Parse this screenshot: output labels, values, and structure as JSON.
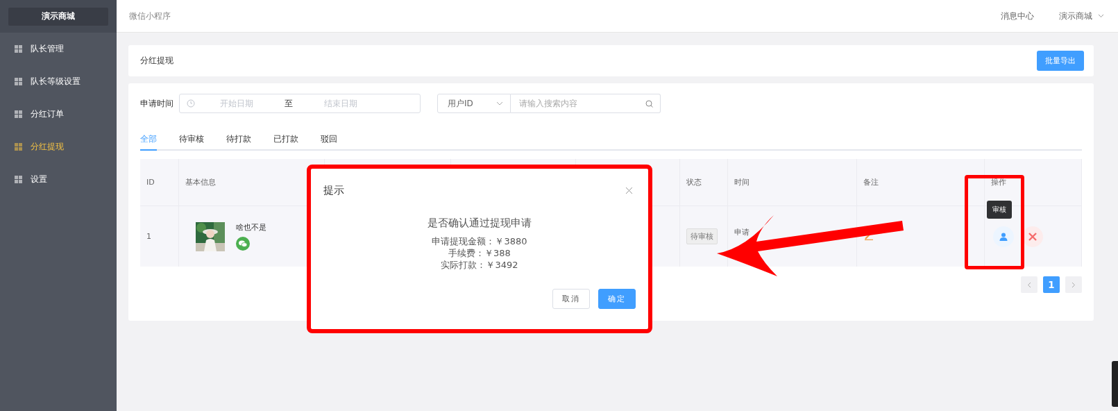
{
  "header": {
    "brand": "演示商城",
    "app_name": "微信小程序",
    "links": [
      "消息中心"
    ],
    "account": "演示商城"
  },
  "sidebar": {
    "items": [
      {
        "label": "队长管理",
        "selected": false
      },
      {
        "label": "队长等级设置",
        "selected": false
      },
      {
        "label": "分红订单",
        "selected": false
      },
      {
        "label": "分红提现",
        "selected": true
      },
      {
        "label": "设置",
        "selected": false
      }
    ]
  },
  "page": {
    "title": "分红提现",
    "export_button": "批量导出"
  },
  "filters": {
    "date_label": "申请时间",
    "start_placeholder": "开始日期",
    "separator": "至",
    "end_placeholder": "结束日期",
    "search_type": "用户ID",
    "search_placeholder": "请输入搜索内容"
  },
  "tabs": [
    {
      "label": "全部",
      "selected": true
    },
    {
      "label": "待审核",
      "selected": false
    },
    {
      "label": "待打款",
      "selected": false
    },
    {
      "label": "已打款",
      "selected": false
    },
    {
      "label": "驳回",
      "selected": false
    }
  ],
  "table": {
    "columns": [
      {
        "label": "ID"
      },
      {
        "label": "基本信息"
      },
      {
        "label": "状态"
      },
      {
        "label": "时间"
      },
      {
        "label": "备注"
      },
      {
        "label": "操作"
      }
    ],
    "rows": [
      {
        "id": "1",
        "nickname": "啥也不是",
        "status": "待审核",
        "time": "申请",
        "tooltip": "审核"
      }
    ]
  },
  "pagination": {
    "pages": [
      {
        "label": "1",
        "selected": true
      }
    ]
  },
  "dialog": {
    "title": "提示",
    "message": "是否确认通过提现申请",
    "details": [
      "申请提现金额：￥3880",
      "手续费：￥388",
      "实际打款：￥3492"
    ],
    "buttons": [
      {
        "label": "取消",
        "kind": "secondary"
      },
      {
        "label": "确定",
        "kind": "primary"
      }
    ]
  }
}
